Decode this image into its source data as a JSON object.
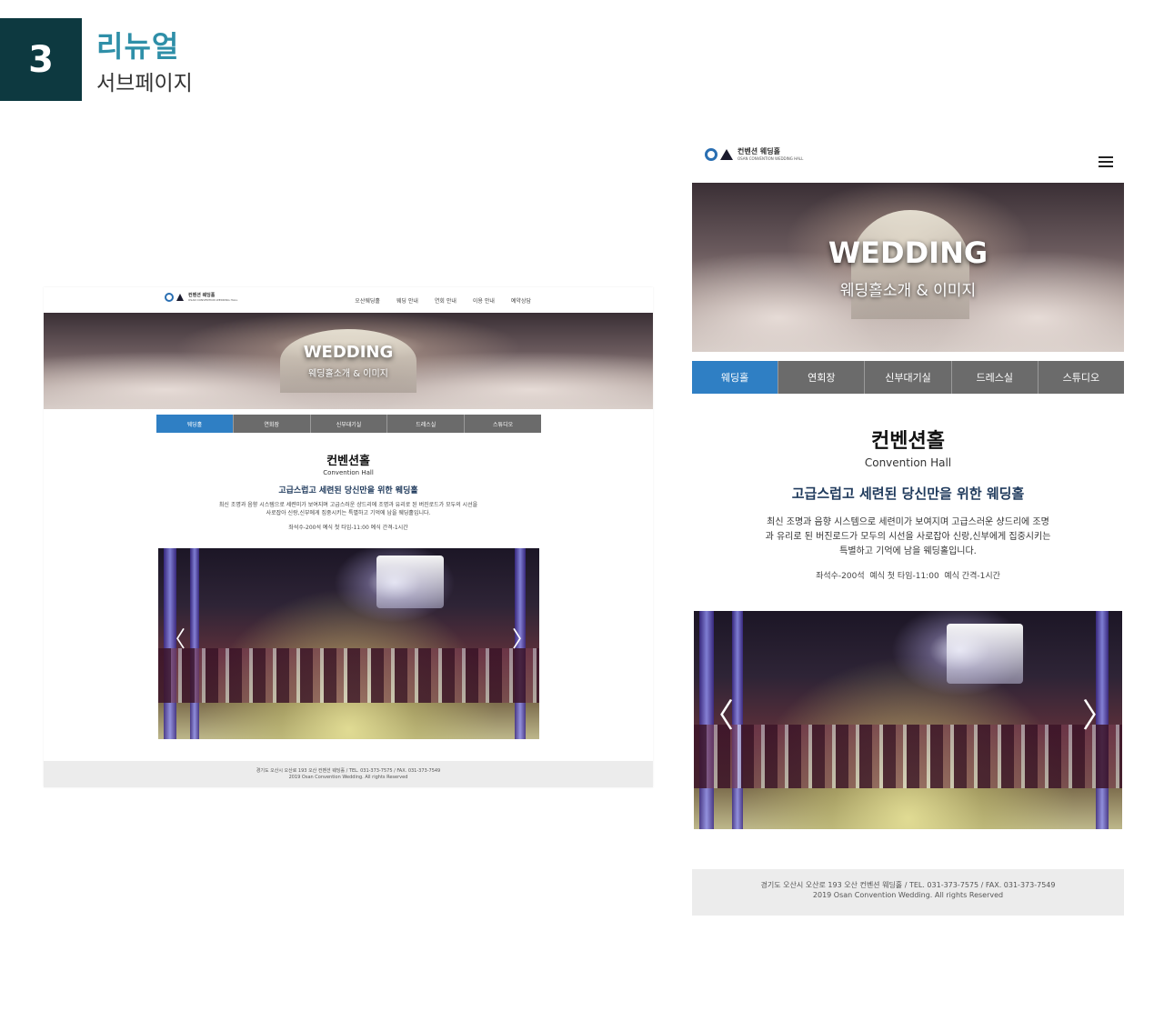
{
  "section": {
    "number": "3",
    "title": "리뉴얼",
    "subtitle": "서브페이지"
  },
  "logo": {
    "korean": "컨벤션 웨딩홀",
    "english": "OSAN CONVENTION WEDDING HALL"
  },
  "desktop": {
    "nav": [
      "오산웨딩홀",
      "웨딩 안내",
      "연회 안내",
      "이용 안내",
      "예약상담"
    ]
  },
  "mobile": {
    "menu_icon": "hamburger-menu-icon"
  },
  "hero": {
    "title": "WEDDING",
    "subtitle": "웨딩홀소개 & 이미지"
  },
  "tabs": [
    {
      "label": "웨딩홀",
      "active": true
    },
    {
      "label": "연회장",
      "active": false
    },
    {
      "label": "신부대기실",
      "active": false
    },
    {
      "label": "드레스실",
      "active": false
    },
    {
      "label": "스튜디오",
      "active": false
    }
  ],
  "content": {
    "heading": "컨벤션홀",
    "heading_en": "Convention Hall",
    "tagline": "고급스럽고 세련된 당신만을 위한 웨딩홀",
    "description_desktop_line1": "최신 조명과 음향 시스템으로 세련미가 보여지며 고급스러운 샹드리에 조명과 유리로 된 버진로드가 모두의 시선을",
    "description_desktop_line2": "사로잡아 신랑,신부에게 집중시키는 특별하고 기억에 남을 웨딩홀입니다.",
    "description_mobile_line1": "최신 조명과 음향 시스템으로 세련미가 보여지며 고급스러운 샹드리에 조명",
    "description_mobile_line2": "과 유리로 된 버진로드가 모두의 시선을 사로잡아 신랑,신부에게 집중시키는",
    "description_mobile_line3": "특별하고 기억에 남을 웨딩홀입니다.",
    "info_desktop": "좌석수-200석 예식 첫 타임-11:00 예식 간격-1시간",
    "info_mobile": "좌석수-200석  예식 첫 타임-11:00  예식 간격-1시간"
  },
  "slider": {
    "prev_icon": "chevron-left-icon",
    "next_icon": "chevron-right-icon",
    "prev_glyph": "〈",
    "next_glyph": "〉"
  },
  "footer": {
    "address": "경기도 오산시 오산로 193 오산 컨벤션 웨딩홀 / TEL. 031-373-7575 / FAX. 031-373-7549",
    "copyright": "2019 Osan Convention Wedding. All rights Reserved"
  }
}
